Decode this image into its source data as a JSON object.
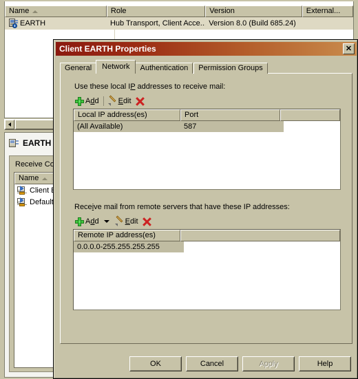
{
  "console": {
    "top_list": {
      "columns": [
        "Name",
        "Role",
        "Version",
        "External..."
      ],
      "sort_column": "Name",
      "sort_direction": "ascending",
      "rows": [
        {
          "name": "EARTH",
          "role": "Hub Transport, Client Acce...",
          "version": "Version 8.0 (Build 685.24)",
          "external": ""
        }
      ]
    },
    "detail": {
      "title": "EARTH",
      "section_label": "Receive Conn",
      "list": {
        "columns": [
          "Name"
        ],
        "sort_direction": "ascending",
        "rows": [
          {
            "name": "Client EAR"
          },
          {
            "name": "Default EA"
          }
        ]
      }
    }
  },
  "dialog": {
    "title": "Client EARTH Properties",
    "close_label": "✕",
    "tabs": [
      {
        "label": "General",
        "selected": false
      },
      {
        "label": "Network",
        "selected": true
      },
      {
        "label": "Authentication",
        "selected": false
      },
      {
        "label": "Permission Groups",
        "selected": false
      }
    ],
    "local_section": {
      "label_pre": "Use these local I",
      "label_accel": "P",
      "label_post": " addresses to receive mail:",
      "toolbar": {
        "add_pre": "A",
        "add_accel": "d",
        "add_post": "d",
        "edit_pre": "",
        "edit_accel": "E",
        "edit_post": "dit",
        "delete_label": ""
      },
      "columns": [
        "Local IP address(es)",
        "Port",
        ""
      ],
      "rows": [
        {
          "address": "(All Available)",
          "port": "587",
          "extra": ""
        }
      ]
    },
    "remote_section": {
      "label_pre": "Rece",
      "label_accel": "i",
      "label_post": "ve mail from remote servers that have these IP addresses:",
      "toolbar": {
        "add_pre": "A",
        "add_accel": "d",
        "add_post": "d",
        "edit_pre": "",
        "edit_accel": "E",
        "edit_post": "dit",
        "has_dropdown": true
      },
      "columns": [
        "Remote IP address(es)",
        ""
      ],
      "rows": [
        {
          "address": "0.0.0.0-255.255.255.255",
          "extra": ""
        }
      ]
    },
    "buttons": [
      {
        "label": "OK",
        "disabled": false
      },
      {
        "label": "Cancel",
        "disabled": false
      },
      {
        "label": "Apply",
        "disabled": true
      },
      {
        "label": "Help",
        "disabled": false
      }
    ]
  },
  "colors": {
    "window_face": "#c7c3a8",
    "title_gradient_start": "#8b1a10",
    "title_gradient_end": "#c98b4c",
    "selection": "#c0bca2",
    "add_icon_green": "#3ec73e",
    "delete_icon_red": "#cc2222"
  }
}
